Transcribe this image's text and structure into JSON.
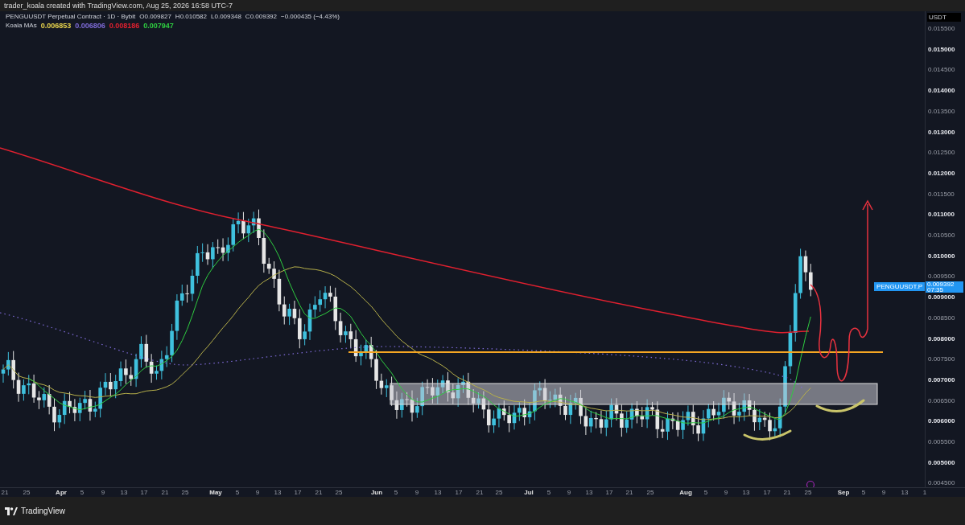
{
  "header": {
    "text": "trader_koala created with TradingView.com, Aug 25, 2026 16:58 UTC-7"
  },
  "legend": {
    "symbol": "PENGUUSDT Perpetual Contract · 1D · Bybit",
    "ohlc": [
      {
        "label": "O",
        "value": "0.009827"
      },
      {
        "label": "H",
        "value": "0.010582"
      },
      {
        "label": "L",
        "value": "0.009348"
      },
      {
        "label": "C",
        "value": "0.009392"
      }
    ],
    "change": "−0.000435 (−4.43%)",
    "indicator": "Koala MAs",
    "ma_values": [
      {
        "value": "0.006853",
        "color": "#e8d44d"
      },
      {
        "value": "0.006806",
        "color": "#7e6bd8"
      },
      {
        "value": "0.008186",
        "color": "#e0202f"
      },
      {
        "value": "0.007947",
        "color": "#2ecc40"
      }
    ]
  },
  "price_axis": {
    "currency": "USDT",
    "ticks": [
      {
        "label": "0.015500",
        "major": false
      },
      {
        "label": "0.015000",
        "major": true
      },
      {
        "label": "0.014500",
        "major": false
      },
      {
        "label": "0.014000",
        "major": true
      },
      {
        "label": "0.013500",
        "major": false
      },
      {
        "label": "0.013000",
        "major": true
      },
      {
        "label": "0.012500",
        "major": false
      },
      {
        "label": "0.012000",
        "major": true
      },
      {
        "label": "0.011500",
        "major": false
      },
      {
        "label": "0.011000",
        "major": true
      },
      {
        "label": "0.010500",
        "major": false
      },
      {
        "label": "0.010000",
        "major": true
      },
      {
        "label": "0.009500",
        "major": false
      },
      {
        "label": "0.009000",
        "major": true
      },
      {
        "label": "0.008500",
        "major": false
      },
      {
        "label": "0.008000",
        "major": true
      },
      {
        "label": "0.007500",
        "major": false
      },
      {
        "label": "0.007000",
        "major": true
      },
      {
        "label": "0.006500",
        "major": false
      },
      {
        "label": "0.006000",
        "major": true
      },
      {
        "label": "0.005500",
        "major": false
      },
      {
        "label": "0.005000",
        "major": true
      },
      {
        "label": "0.004500",
        "major": false
      }
    ]
  },
  "price_tag": {
    "symbol": "PENGUUSDT.P",
    "price": "0.009392",
    "countdown": "07:35"
  },
  "time_axis": {
    "ticks": [
      {
        "label": "21",
        "major": false
      },
      {
        "label": "25",
        "major": false
      },
      {
        "label": "Apr",
        "major": true
      },
      {
        "label": "5",
        "major": false
      },
      {
        "label": "9",
        "major": false
      },
      {
        "label": "13",
        "major": false
      },
      {
        "label": "17",
        "major": false
      },
      {
        "label": "21",
        "major": false
      },
      {
        "label": "25",
        "major": false
      },
      {
        "label": "May",
        "major": true
      },
      {
        "label": "5",
        "major": false
      },
      {
        "label": "9",
        "major": false
      },
      {
        "label": "13",
        "major": false
      },
      {
        "label": "17",
        "major": false
      },
      {
        "label": "21",
        "major": false
      },
      {
        "label": "25",
        "major": false
      },
      {
        "label": "Jun",
        "major": true
      },
      {
        "label": "5",
        "major": false
      },
      {
        "label": "9",
        "major": false
      },
      {
        "label": "13",
        "major": false
      },
      {
        "label": "17",
        "major": false
      },
      {
        "label": "21",
        "major": false
      },
      {
        "label": "25",
        "major": false
      },
      {
        "label": "Jul",
        "major": true
      },
      {
        "label": "5",
        "major": false
      },
      {
        "label": "9",
        "major": false
      },
      {
        "label": "13",
        "major": false
      },
      {
        "label": "17",
        "major": false
      },
      {
        "label": "21",
        "major": false
      },
      {
        "label": "25",
        "major": false
      },
      {
        "label": "Aug",
        "major": true
      },
      {
        "label": "5",
        "major": false
      },
      {
        "label": "9",
        "major": false
      },
      {
        "label": "13",
        "major": false
      },
      {
        "label": "17",
        "major": false
      },
      {
        "label": "21",
        "major": false
      },
      {
        "label": "25",
        "major": false
      },
      {
        "label": "Sep",
        "major": true
      },
      {
        "label": "5",
        "major": false
      },
      {
        "label": "9",
        "major": false
      },
      {
        "label": "13",
        "major": false
      },
      {
        "label": "1",
        "major": false
      }
    ]
  },
  "footer": {
    "brand": "TradingView"
  }
}
